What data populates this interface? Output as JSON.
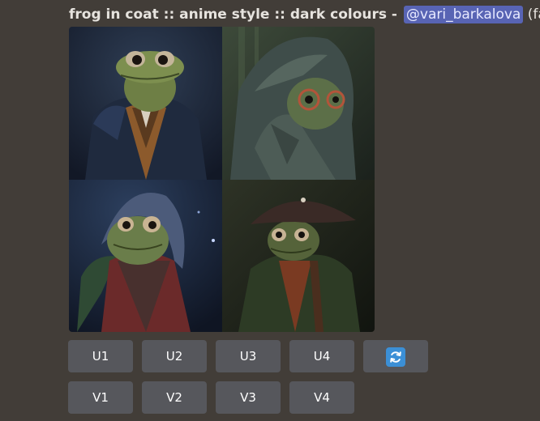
{
  "message": {
    "prompt": "frog in coat :: anime style :: dark colours",
    "separator": " - ",
    "mention": "@vari_barkalova",
    "speed": "(fast)"
  },
  "image_grid": {
    "tiles": [
      {
        "icon": "frog-portrait-brown-coat"
      },
      {
        "icon": "frog-portrait-hood-glasses"
      },
      {
        "icon": "frog-portrait-red-jacket-hood"
      },
      {
        "icon": "frog-portrait-hat-green-coat"
      }
    ]
  },
  "buttons": {
    "upscale": [
      "U1",
      "U2",
      "U3",
      "U4"
    ],
    "variation": [
      "V1",
      "V2",
      "V3",
      "V4"
    ],
    "reroll_icon": "refresh-icon"
  },
  "colors": {
    "background": "#423d38",
    "button": "#56575c",
    "mention": "#5864b4",
    "reroll": "#3b8fd6"
  }
}
